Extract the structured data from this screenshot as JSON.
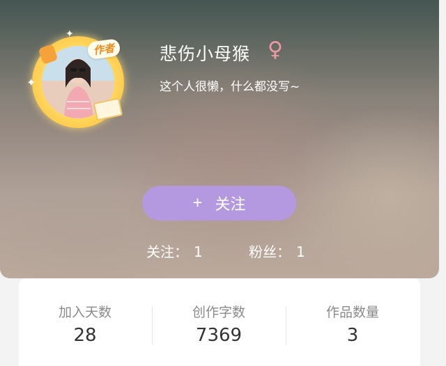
{
  "profile": {
    "username": "悲伤小母猴",
    "gender_symbol": "♀",
    "bio": "这个人很懒，什么都没写~",
    "author_badge": "作者"
  },
  "actions": {
    "follow_plus": "+",
    "follow_label": "关注"
  },
  "social": {
    "following_label": "关注：",
    "following_count": "1",
    "fans_label": "粉丝：",
    "fans_count": "1"
  },
  "metrics": [
    {
      "label": "加入天数",
      "value": "28"
    },
    {
      "label": "创作字数",
      "value": "7369"
    },
    {
      "label": "作品数量",
      "value": "3"
    }
  ],
  "colors": {
    "follow_button": "#b599e0",
    "gender_icon": "#f29aa3",
    "author_badge_text": "#f08a1c"
  },
  "icons": {
    "gender": "female-icon",
    "follow": "plus-icon"
  }
}
